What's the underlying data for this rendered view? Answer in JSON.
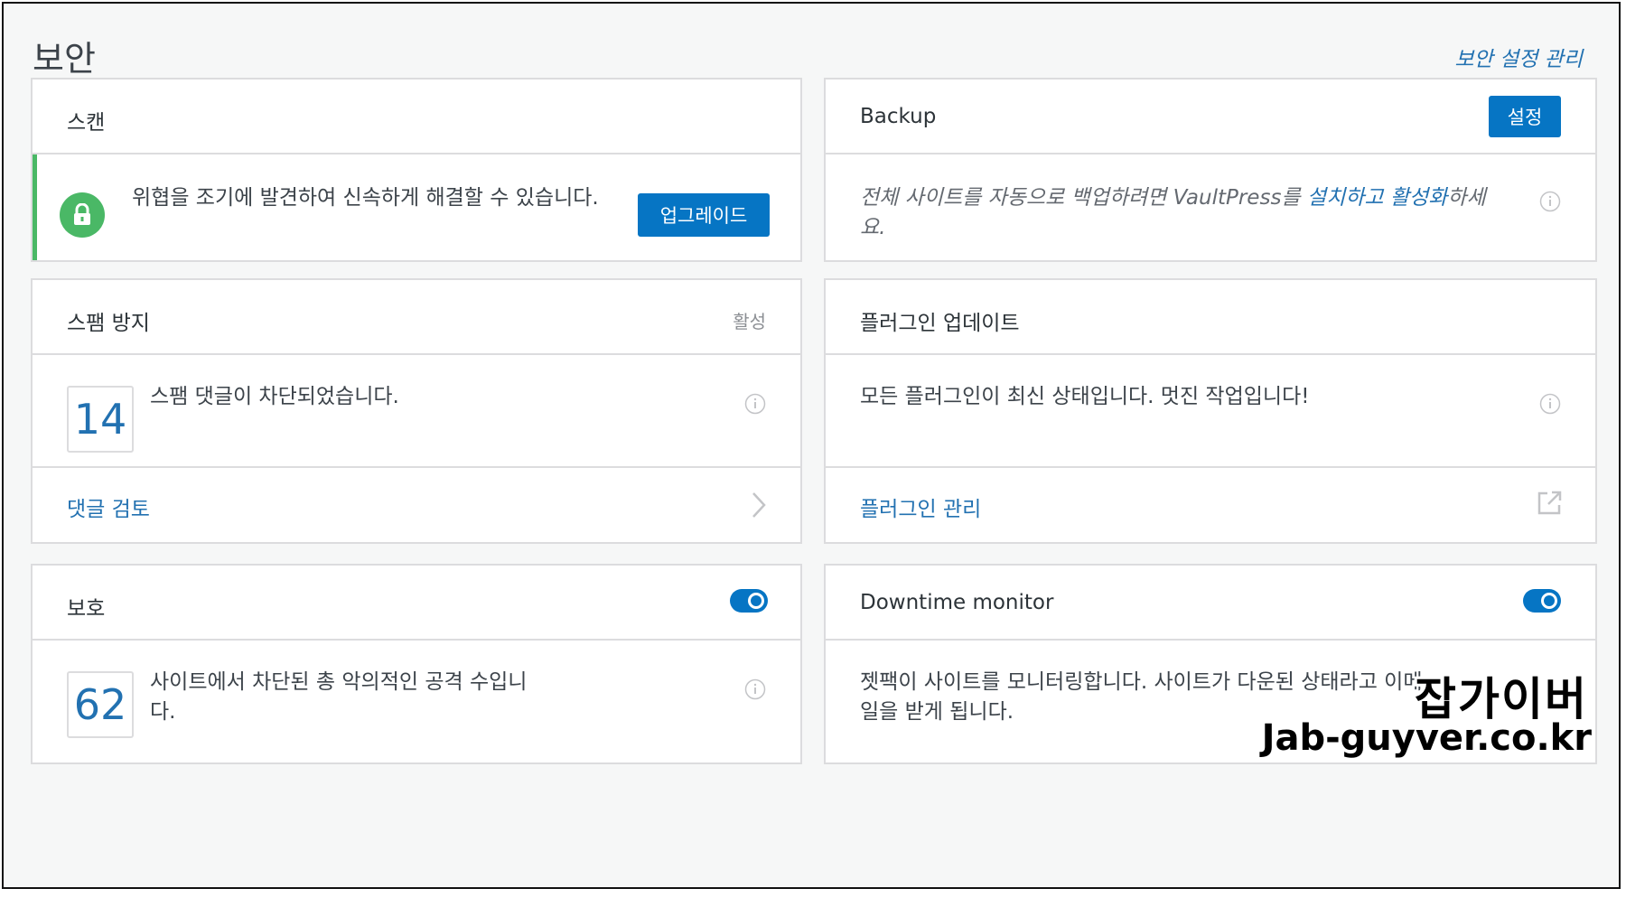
{
  "header": {
    "title": "보안",
    "manage_link": "보안 설정 관리"
  },
  "scan": {
    "title": "스캔",
    "message": "위협을 조기에 발견하여 신속하게 해결할 수 있습니다.",
    "upgrade_label": "업그레이드"
  },
  "backup": {
    "title": "Backup",
    "settings_label": "설정",
    "message_pre": "전체 사이트를 자동으로 백업하려면 VaultPress를 ",
    "link_install": "설치하고",
    "link_activate": "활성화",
    "message_post": "하세요."
  },
  "antispam": {
    "title": "스팸 방지",
    "status": "활성",
    "count": "14",
    "message": "스팸 댓글이 차단되었습니다.",
    "footer_link": "댓글 검토"
  },
  "plugins": {
    "title": "플러그인 업데이트",
    "message": "모든 플러그인이 최신 상태입니다. 멋진 작업입니다!",
    "footer_link": "플러그인 관리"
  },
  "protect": {
    "title": "보호",
    "count": "62",
    "message": "사이트에서 차단된 총 악의적인 공격 수입니다.",
    "toggle_on": true
  },
  "downtime": {
    "title": "Downtime monitor",
    "message": "젯팩이 사이트를 모니터링합니다. 사이트가 다운된 상태라고 이메일을 받게 됩니다.",
    "toggle_on": true
  },
  "watermark": {
    "korean": "잡가이버",
    "url": "Jab-guyver.co.kr"
  },
  "colors": {
    "accent_blue": "#0675c4",
    "link_blue": "#2271b1",
    "success_green": "#4ab866"
  },
  "icons": [
    "lock-icon",
    "info-icon",
    "chevron-right-icon",
    "external-link-icon"
  ]
}
